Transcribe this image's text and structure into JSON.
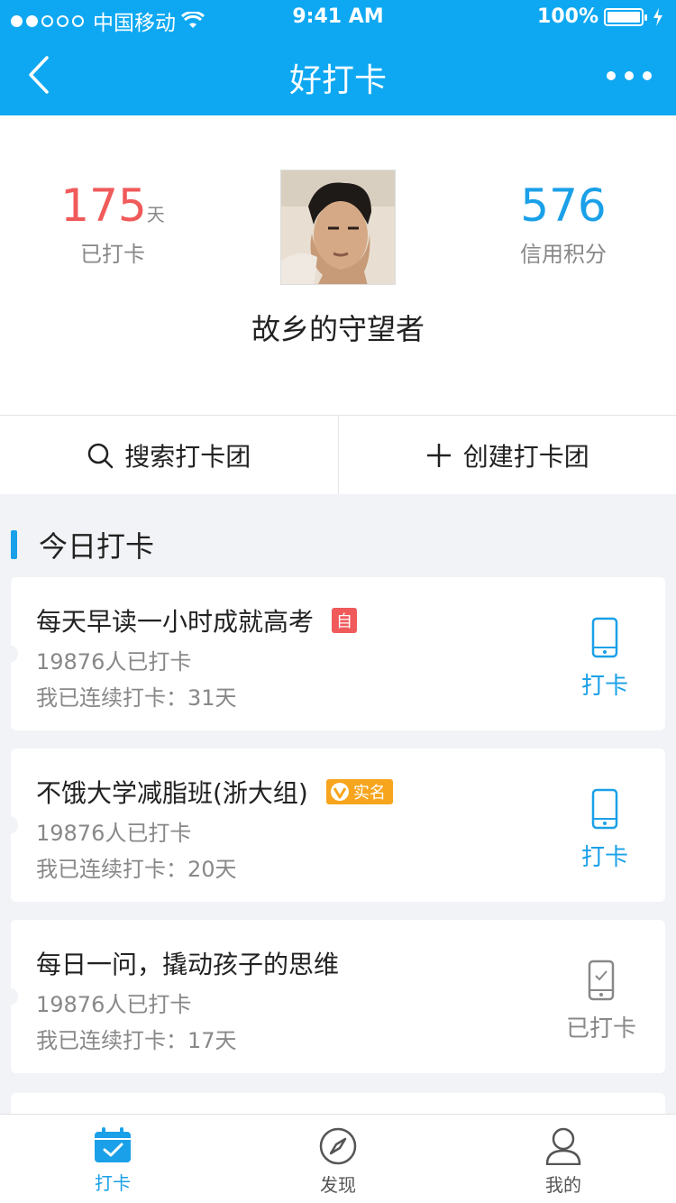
{
  "status_bar": {
    "carrier": "中国移动",
    "time": "9:41 AM",
    "battery": "100%"
  },
  "nav": {
    "title": "好打卡"
  },
  "profile": {
    "days_value": "175",
    "days_unit": "天",
    "days_label": "已打卡",
    "credit_value": "576",
    "credit_label": "信用积分",
    "nickname": "故乡的守望者"
  },
  "actions": {
    "search_label": "搜索打卡团",
    "create_label": "创建打卡团"
  },
  "section": {
    "title": "今日打卡"
  },
  "cards": [
    {
      "title": "每天早读一小时成就高考",
      "tag": "自",
      "members": "19876人已打卡",
      "streak": "我已连续打卡：31天",
      "action": "打卡"
    },
    {
      "title": "不饿大学减脂班(浙大组)",
      "tag": "实名",
      "members": "19876人已打卡",
      "streak": "我已连续打卡：20天",
      "action": "打卡"
    },
    {
      "title": "每日一问，撬动孩子的思维",
      "members": "19876人已打卡",
      "streak": "我已连续打卡：17天",
      "action": "已打卡"
    }
  ],
  "tabbar": {
    "tab1": "打卡",
    "tab2": "发现",
    "tab3": "我的"
  },
  "colors": {
    "primary": "#0ea8f2",
    "accent": "#1aa0e8",
    "red": "#f05a5a",
    "gold": "#f7a51d"
  }
}
